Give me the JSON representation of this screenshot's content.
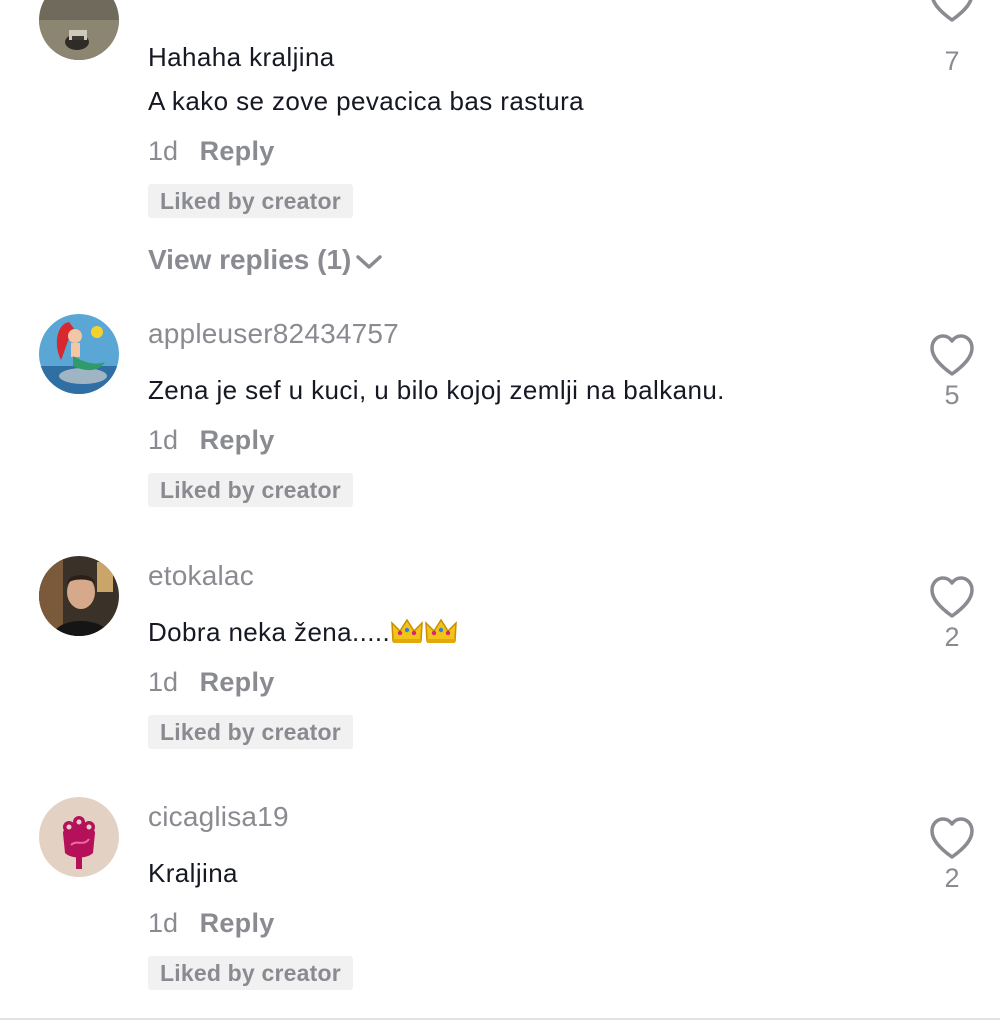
{
  "comments": [
    {
      "username": "",
      "text_lines": [
        "Hahaha kraljina",
        "A kako se zove pevacica bas rastura"
      ],
      "time": "1d",
      "reply_label": "Reply",
      "badge": "Liked by creator",
      "view_replies": "View replies (1)",
      "like_count": "7"
    },
    {
      "username": "appleuser82434757",
      "text": "Zena je sef u kuci, u bilo kojoj zemlji na balkanu.",
      "time": "1d",
      "reply_label": "Reply",
      "badge": "Liked by creator",
      "like_count": "5"
    },
    {
      "username": "etokalac",
      "text": "Dobra neka žena.....",
      "emoji": [
        "crown-icon",
        "crown-icon"
      ],
      "time": "1d",
      "reply_label": "Reply",
      "badge": "Liked by creator",
      "like_count": "2"
    },
    {
      "username": "cicaglisa19",
      "text": "Kraljina",
      "time": "1d",
      "reply_label": "Reply",
      "badge": "Liked by creator",
      "like_count": "2"
    }
  ],
  "colors": {
    "text_primary": "#161823",
    "text_secondary": "#8a8b91",
    "badge_bg": "#f1f1f2"
  }
}
